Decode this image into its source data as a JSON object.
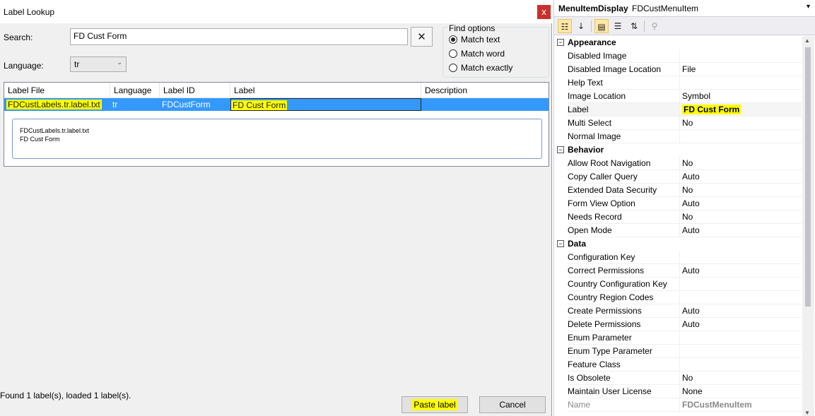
{
  "dialog": {
    "title": "Label Lookup",
    "close_glyph": "x",
    "search_label": "Search:",
    "search_value": "FD Cust Form",
    "clear_glyph": "✕",
    "language_label": "Language:",
    "language_value": "tr",
    "find_options": {
      "legend": "Find options",
      "options": [
        "Match text",
        "Match word",
        "Match exactly"
      ],
      "selected": "Match text"
    },
    "grid": {
      "columns": [
        "Label File",
        "Language",
        "Label ID",
        "Label",
        "Description"
      ],
      "row": {
        "label_file": "FDCustLabels.tr.label.txt",
        "language": "tr",
        "label_id": "FDCustForm",
        "label": "FD Cust Form",
        "description": ""
      },
      "detail_line1": "FDCustLabels.tr.label.txt",
      "detail_line2": "FD Cust Form"
    },
    "status": "Found 1 label(s), loaded 1 label(s).",
    "paste_label": "Paste label",
    "cancel_label": "Cancel",
    "highlight_color": "#ffff00",
    "selection_color": "#3399ff"
  },
  "properties": {
    "object_type": "MenuItemDisplay",
    "object_name": "FDCustMenuItem",
    "toolbar": [
      "categorized-icon",
      "alphabetical-icon",
      "properties-icon",
      "events-icon",
      "sort-icon",
      "wrench-icon"
    ],
    "categories": [
      {
        "name": "Appearance",
        "rows": [
          {
            "name": "Disabled Image",
            "value": ""
          },
          {
            "name": "Disabled Image Location",
            "value": "File"
          },
          {
            "name": "Help Text",
            "value": ""
          },
          {
            "name": "Image Location",
            "value": "Symbol"
          },
          {
            "name": "Label",
            "value": "FD Cust Form"
          },
          {
            "name": "Multi Select",
            "value": "No"
          },
          {
            "name": "Normal Image",
            "value": ""
          }
        ]
      },
      {
        "name": "Behavior",
        "rows": [
          {
            "name": "Allow Root Navigation",
            "value": "No"
          },
          {
            "name": "Copy Caller Query",
            "value": "Auto"
          },
          {
            "name": "Extended Data Security",
            "value": "No"
          },
          {
            "name": "Form View Option",
            "value": "Auto"
          },
          {
            "name": "Needs Record",
            "value": "No"
          },
          {
            "name": "Open Mode",
            "value": "Auto"
          }
        ]
      },
      {
        "name": "Data",
        "rows": [
          {
            "name": "Configuration Key",
            "value": ""
          },
          {
            "name": "Correct Permissions",
            "value": "Auto"
          },
          {
            "name": "Country Configuration Key",
            "value": ""
          },
          {
            "name": "Country Region Codes",
            "value": ""
          },
          {
            "name": "Create Permissions",
            "value": "Auto"
          },
          {
            "name": "Delete Permissions",
            "value": "Auto"
          },
          {
            "name": "Enum Parameter",
            "value": ""
          },
          {
            "name": "Enum Type Parameter",
            "value": ""
          },
          {
            "name": "Feature Class",
            "value": ""
          },
          {
            "name": "Is Obsolete",
            "value": "No"
          },
          {
            "name": "Maintain User License",
            "value": "None"
          },
          {
            "name": "Name",
            "value": "FDCustMenuItem"
          }
        ]
      }
    ]
  }
}
